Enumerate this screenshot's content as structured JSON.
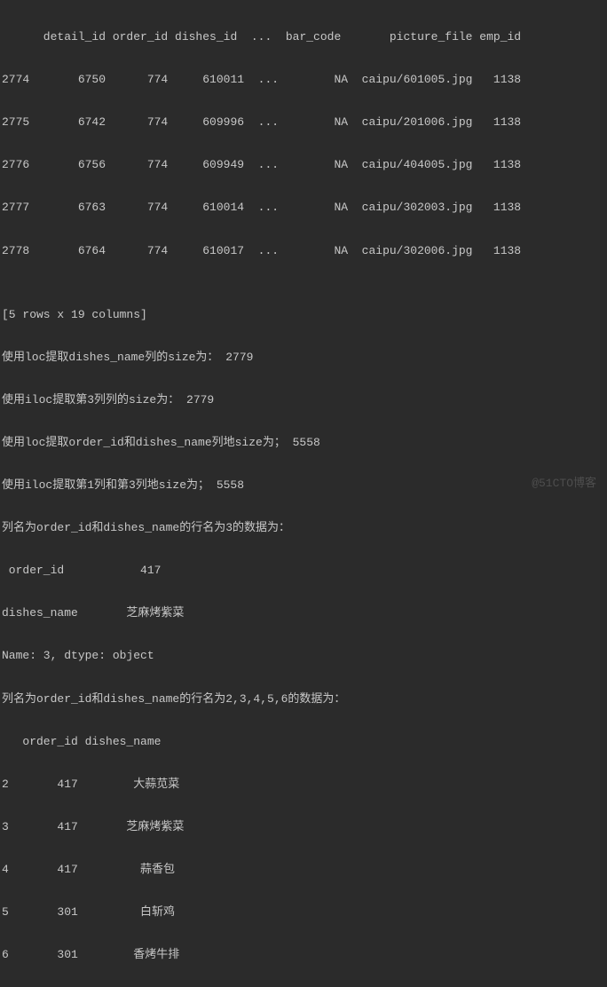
{
  "console": {
    "header": "      detail_id order_id dishes_id  ...  bar_code       picture_file emp_id",
    "rows": [
      "2774       6750      774     610011  ...        NA  caipu/601005.jpg   1138",
      "2775       6742      774     609996  ...        NA  caipu/201006.jpg   1138",
      "2776       6756      774     609949  ...        NA  caipu/404005.jpg   1138",
      "2777       6763      774     610014  ...        NA  caipu/302003.jpg   1138",
      "2778       6764      774     610017  ...        NA  caipu/302006.jpg   1138"
    ],
    "blank1": "",
    "shape": "[5 rows x 19 columns]",
    "loc_size": "使用loc提取dishes_name列的size为： 2779",
    "iloc_size": "使用iloc提取第3列列的size为： 2779",
    "loc_multi_size": "使用loc提取order_id和dishes_name列地size为； 5558",
    "iloc_multi_size": "使用iloc提取第1列和第3列地size为； 5558",
    "row3_label": "列名为order_id和dishes_name的行名为3的数据为：",
    "row3_out1": " order_id           417",
    "row3_out2": "dishes_name       芝麻烤紫菜",
    "row3_out3": "Name: 3, dtype: object",
    "rows_label": "列名为order_id和dishes_name的行名为2,3,4,5,6的数据为：",
    "rows_header": "   order_id dishes_name",
    "rows_data": [
      "2       417        大蒜苋菜",
      "3       417       芝麻烤紫菜",
      "4       417         蒜香包",
      "5       301         白斩鸡",
      "6       301        香烤牛排"
    ]
  },
  "watermark": "@51CTO博客"
}
